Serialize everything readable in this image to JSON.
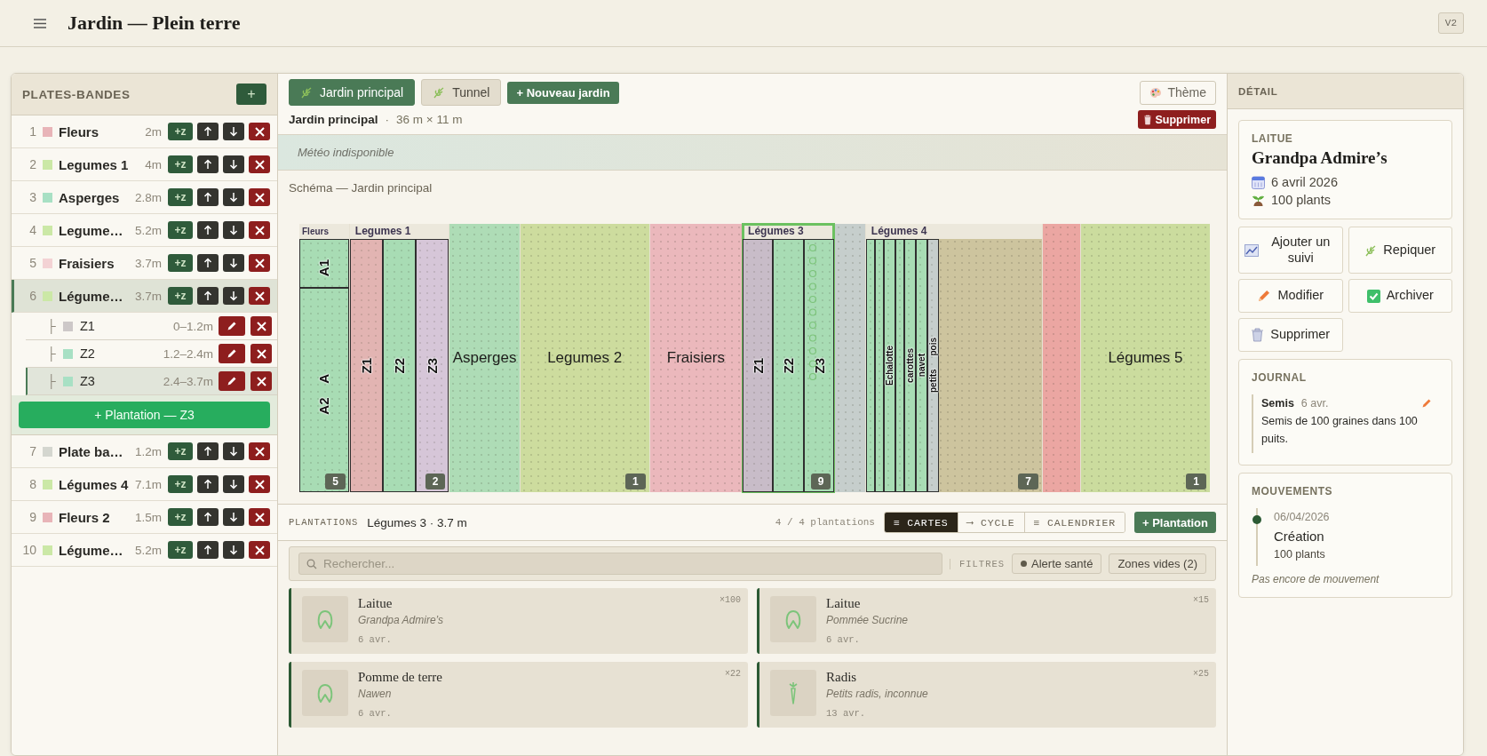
{
  "header": {
    "title": "Jardin — Plein terre",
    "version": "V2"
  },
  "sidebar": {
    "title": "PLATES-BANDES",
    "add": "+",
    "beds": [
      {
        "number": "1",
        "color": "#e8b4b8",
        "name": "Fleurs",
        "size": "2m",
        "add_zone": "+z",
        "selected": false
      },
      {
        "number": "2",
        "color": "#cbe8a6",
        "name": "Legumes 1",
        "size": "4m",
        "add_zone": "+z",
        "selected": false
      },
      {
        "number": "3",
        "color": "#a8e0c4",
        "name": "Asperges",
        "size": "2.8m",
        "add_zone": "+z",
        "selected": false
      },
      {
        "number": "4",
        "color": "#cbe8a6",
        "name": "Legume…",
        "size": "5.2m",
        "add_zone": "+z",
        "selected": false
      },
      {
        "number": "5",
        "color": "#f3d2d4",
        "name": "Fraisiers",
        "size": "3.7m",
        "add_zone": "+z",
        "selected": false
      },
      {
        "number": "6",
        "color": "#cbe8a6",
        "name": "Légume…",
        "size": "3.7m",
        "add_zone": "+z",
        "selected": true,
        "zones": [
          {
            "glyph": "├",
            "color": "#cdc8c8",
            "name": "Z1",
            "range": "0–1.2m",
            "selected": false
          },
          {
            "glyph": "├",
            "color": "#a8e0c4",
            "name": "Z2",
            "range": "1.2–2.4m",
            "selected": false
          },
          {
            "glyph": "├",
            "color": "#a8e0c4",
            "name": "Z3",
            "range": "2.4–3.7m",
            "selected": true
          }
        ],
        "add_plantation": "+ Plantation — Z3"
      },
      {
        "number": "7",
        "color": "#d4d6cf",
        "name": "Plate ba…",
        "size": "1.2m",
        "add_zone": "+z",
        "selected": false
      },
      {
        "number": "8",
        "color": "#cbe8a6",
        "name": "Légumes 4",
        "size": "7.1m",
        "add_zone": "+z",
        "selected": false
      },
      {
        "number": "9",
        "color": "#e8b4b8",
        "name": "Fleurs 2",
        "size": "1.5m",
        "add_zone": "+z",
        "selected": false
      },
      {
        "number": "10",
        "color": "#cbe8a6",
        "name": "Légume…",
        "size": "5.2m",
        "add_zone": "+z",
        "selected": false
      }
    ]
  },
  "gardens": {
    "tabs": [
      {
        "label": "Jardin principal",
        "selected": true
      },
      {
        "label": "Tunnel",
        "selected": false
      }
    ],
    "new_garden": "+ Nouveau jardin",
    "theme": "Thème",
    "name": "Jardin principal",
    "separator": "·",
    "dimensions": "36 m × 11 m",
    "delete": "Supprimer"
  },
  "weather": "Météo indisponible",
  "plan": {
    "title": "Schéma — Jardin principal",
    "beds": [
      {
        "label": "Fleurs",
        "kind": "rows",
        "count": "5",
        "selected": false,
        "zones": [
          {
            "label": "A1",
            "color": "#a8dcb4"
          },
          {
            "label": "A2 A",
            "color": "#a8dcb4"
          }
        ]
      },
      {
        "label": "Legumes 1",
        "kind": "columns",
        "count": "2",
        "selected": false,
        "zones": [
          {
            "label": "Z1",
            "color": "#e2b4b2"
          },
          {
            "label": "Z2",
            "color": "#a8dcb4"
          },
          {
            "label": "Z3",
            "color": "#d6c6d8"
          }
        ]
      },
      {
        "label": "Asperges",
        "kind": "plain",
        "color": "#aedcb6",
        "selected": false
      },
      {
        "label": "Legumes 2",
        "kind": "plain",
        "color": "#cddc9e",
        "count": "1",
        "selected": false
      },
      {
        "label": "Fraisiers",
        "kind": "plain",
        "color": "#ebb8bc",
        "selected": false
      },
      {
        "label": "Légumes 3",
        "kind": "columns",
        "count": "9",
        "selected": true,
        "zones": [
          {
            "label": "Z1",
            "color": "#c8bcc8",
            "planted": false
          },
          {
            "label": "Z2",
            "color": "#a8dcb4",
            "planted": false
          },
          {
            "label": "Z3",
            "color": "#a8dcb4",
            "planted": true
          }
        ]
      },
      {
        "kind": "plain",
        "color": "#c6cecc",
        "selected": false
      },
      {
        "label": "Légumes 4",
        "kind": "strips",
        "color": "#cdc49e",
        "count": "7",
        "selected": false,
        "zones": [
          {
            "color": "#a8dcb4"
          },
          {
            "color": "#a8dcb4"
          },
          {
            "label": "Echalotte",
            "color": "#a8dcb4"
          },
          {
            "color": "#a8dcb4"
          },
          {
            "label": "carottes",
            "color": "#a8dcb4"
          },
          {
            "label": "navet",
            "color": "#a8dcb4"
          },
          {
            "label": "petits pois",
            "color": "#c6cecc"
          }
        ]
      },
      {
        "kind": "plain",
        "color": "#eba6a2",
        "selected": false
      },
      {
        "label": "Légumes 5",
        "kind": "plain",
        "color": "#cbdc9e",
        "count": "1",
        "selected": false
      }
    ]
  },
  "plantations": {
    "label": "PLANTATIONS",
    "context": "Légumes 3 · 3.7 m",
    "count": "4 / 4 plantations",
    "views": [
      {
        "icon": "≡",
        "label": "CARTES",
        "selected": true
      },
      {
        "icon": "⟶",
        "label": "CYCLE",
        "selected": false
      },
      {
        "icon": "≡",
        "label": "CALENDRIER",
        "selected": false
      }
    ],
    "add": "+ Plantation",
    "search_placeholder": "Rechercher...",
    "filters_label": "FILTRES",
    "filters": [
      {
        "label": "Alerte santé",
        "kind": "dot"
      },
      {
        "label": "Zones vides (2)",
        "kind": "plain"
      }
    ],
    "cards": [
      {
        "name": "Laitue",
        "variety": "Grandpa Admire’s",
        "date": "6 avr.",
        "count": "×100",
        "kind": "leafy"
      },
      {
        "name": "Laitue",
        "variety": "Pommée Sucrine",
        "date": "6 avr.",
        "count": "×15",
        "kind": "leafy"
      },
      {
        "name": "Pomme de terre",
        "variety": "Nawen",
        "date": "6 avr.",
        "count": "×22",
        "kind": "leafy"
      },
      {
        "name": "Radis",
        "variety": "Petits radis, inconnue",
        "date": "13 avr.",
        "count": "×25",
        "kind": "root"
      }
    ]
  },
  "detail": {
    "title": "DÉTAIL",
    "species": "LAITUE",
    "variety": "Grandpa Admire’s",
    "date": "6 avril 2026",
    "quantity": "100 plants",
    "actions": [
      {
        "label": "Ajouter un suivi",
        "kind": "chart"
      },
      {
        "label": "Repiquer",
        "kind": "leaf"
      },
      {
        "label": "Modifier",
        "kind": "pencil"
      },
      {
        "label": "Archiver",
        "kind": "check"
      },
      {
        "label": "Supprimer",
        "kind": "trash"
      }
    ],
    "journal": {
      "title": "JOURNAL",
      "entries": [
        {
          "type": "Semis",
          "date": "6 avr.",
          "text": "Semis de 100 graines dans 100 puits."
        }
      ]
    },
    "movements": {
      "title": "MOUVEMENTS",
      "entries": [
        {
          "date": "06/04/2026",
          "title": "Création",
          "detail": "100 plants"
        }
      ],
      "empty": "Pas encore de mouvement"
    }
  }
}
